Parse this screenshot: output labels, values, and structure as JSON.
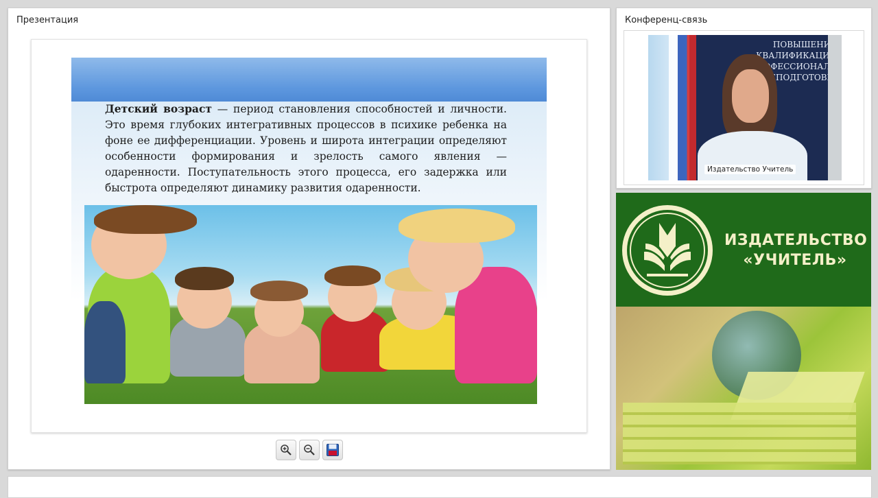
{
  "presentation": {
    "title": "Презентация",
    "slide": {
      "text_bold": "Детский возраст",
      "text_rest": " — период становления способностей и личности. Это время глубоких интегративных процессов в психике ребенка на фоне ее дифференциации. Уровень и широта интеграции определяют особенности формирования и зрелость самого явления — одаренности. Поступательность этого процесса, его задержка или быстрота определяют динамику развития одаренности."
    },
    "toolbar": {
      "zoom_in_icon": "zoom-in-icon",
      "zoom_out_icon": "zoom-out-icon",
      "save_icon": "save-icon"
    }
  },
  "conference": {
    "title": "Конференц-связь",
    "video": {
      "caption": "Издательство Учитель",
      "backdrop_lines": [
        "ПОВЫШЕНИЕ",
        "КВАЛИФИКАЦИИ",
        "ПРОФЕССИОНАЛЬНАЯ",
        "ПЕРЕПОДГОТОВКА"
      ]
    }
  },
  "banner": {
    "name_line1": "ИЗДАТЕЛЬСТВО",
    "name_line2": "«УЧИТЕЛЬ»"
  },
  "colors": {
    "banner_green": "#1f6a1a",
    "banner_text": "#f4f0c8",
    "slide_header_blue": "#5d97de"
  }
}
